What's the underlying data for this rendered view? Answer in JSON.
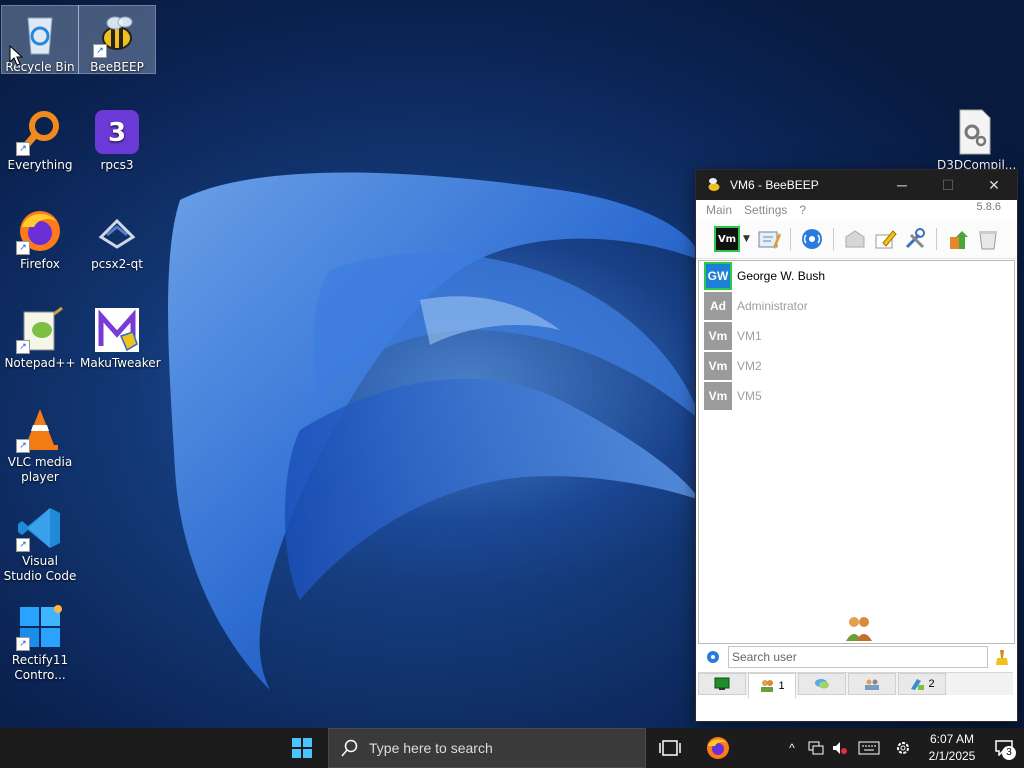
{
  "desktop": {
    "icons": [
      {
        "label": "Recycle Bin",
        "icon": "recycle-bin-icon"
      },
      {
        "label": "BeeBEEP",
        "icon": "beebeep-bee-icon"
      },
      {
        "label": "Everything",
        "icon": "magnifier-icon"
      },
      {
        "label": "rpcs3",
        "icon": "rpcs3-icon"
      },
      {
        "label": "Firefox",
        "icon": "firefox-icon"
      },
      {
        "label": "pcsx2-qt",
        "icon": "pcsx2-icon"
      },
      {
        "label": "Notepad++",
        "icon": "notepadpp-icon"
      },
      {
        "label": "MakuTweaker",
        "icon": "makutweaker-icon"
      },
      {
        "label": "VLC media player",
        "icon": "vlc-cone-icon"
      },
      {
        "label": "Visual Studio Code",
        "icon": "vscode-icon"
      },
      {
        "label": "Rectify11 Contro...",
        "icon": "rectify11-icon"
      },
      {
        "label": "D3DCompil...",
        "icon": "settings-file-icon"
      }
    ]
  },
  "beebeep": {
    "title": "VM6 - BeeBEEP",
    "menu": [
      "Main",
      "Settings",
      "?"
    ],
    "version": "5.8.6",
    "status_button_label": "Vm",
    "users": [
      {
        "initials": "GW",
        "name": "George W. Bush",
        "online": true
      },
      {
        "initials": "Ad",
        "name": "Administrator",
        "online": false
      },
      {
        "initials": "Vm",
        "name": "VM1",
        "online": false
      },
      {
        "initials": "Vm",
        "name": "VM2",
        "online": false
      },
      {
        "initials": "Vm",
        "name": "VM5",
        "online": false
      }
    ],
    "search_placeholder": "Search user",
    "tabs": [
      {
        "icon": "monitor-icon",
        "count": ""
      },
      {
        "icon": "users-icon",
        "count": "1"
      },
      {
        "icon": "chat-icon",
        "count": ""
      },
      {
        "icon": "groups-icon",
        "count": ""
      },
      {
        "icon": "files-icon",
        "count": "2"
      }
    ]
  },
  "taskbar": {
    "search_placeholder": "Type here to search",
    "time": "6:07 AM",
    "date": "2/1/2025",
    "notifications_count": "3"
  },
  "colors": {
    "taskbar_bg": "#1c1c1c",
    "online_avatar": "#1e7fd8",
    "offline_avatar": "#9b9b9b"
  }
}
